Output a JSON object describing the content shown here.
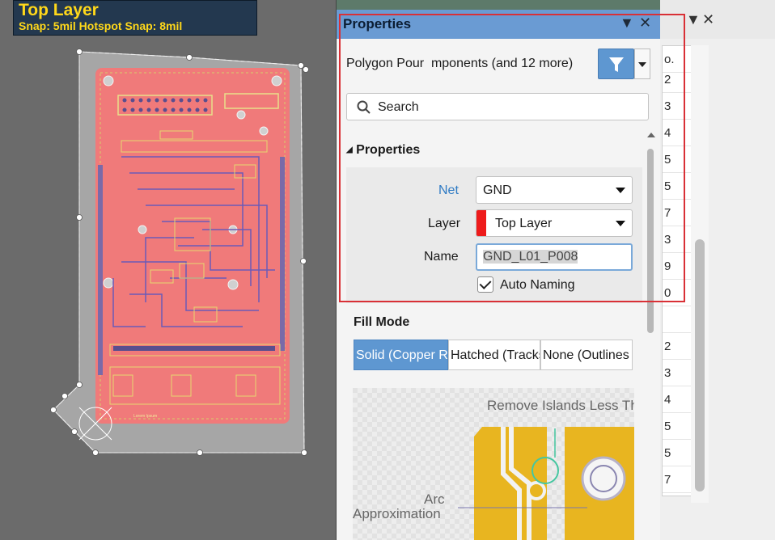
{
  "hud": {
    "layer": "Top Layer",
    "snap": "Snap: 5mil Hotspot Snap: 8mil"
  },
  "panel": {
    "title": "Properties",
    "filter_text": "Polygon Pour  mponents (and 12 more)",
    "search_placeholder": "Search",
    "section_title": "Properties",
    "net_label": "Net",
    "net_value": "GND",
    "layer_label": "Layer",
    "layer_value": "Top Layer",
    "layer_color": "#ee1b1b",
    "name_label": "Name",
    "name_value": "GND_L01_P008",
    "auto_naming_label": "Auto Naming",
    "auto_naming_checked": true,
    "fill_mode_title": "Fill Mode",
    "fill_mode_options": [
      "Solid (Copper R",
      "Hatched (Tracks",
      "None (Outlines"
    ],
    "fill_mode_selected": "Solid (Copper R",
    "preview": {
      "callout_islands": "Remove Islands Less Th",
      "callout_arc": "Arc",
      "callout_approx": "Approximation"
    }
  },
  "background_panel": {
    "header_text": "o.",
    "column_digits": [
      "2",
      "3",
      "4",
      "5",
      "5",
      "7",
      "3",
      "9",
      "0",
      "",
      "2",
      "3",
      "4",
      "5",
      "5",
      "7"
    ]
  },
  "colors": {
    "panel_header": "#6a9bd3",
    "highlight_frame": "#d93036",
    "selected_segment": "#5e97d1",
    "hud_text": "#ffd81a",
    "pcb_board": "#f07a7a"
  }
}
